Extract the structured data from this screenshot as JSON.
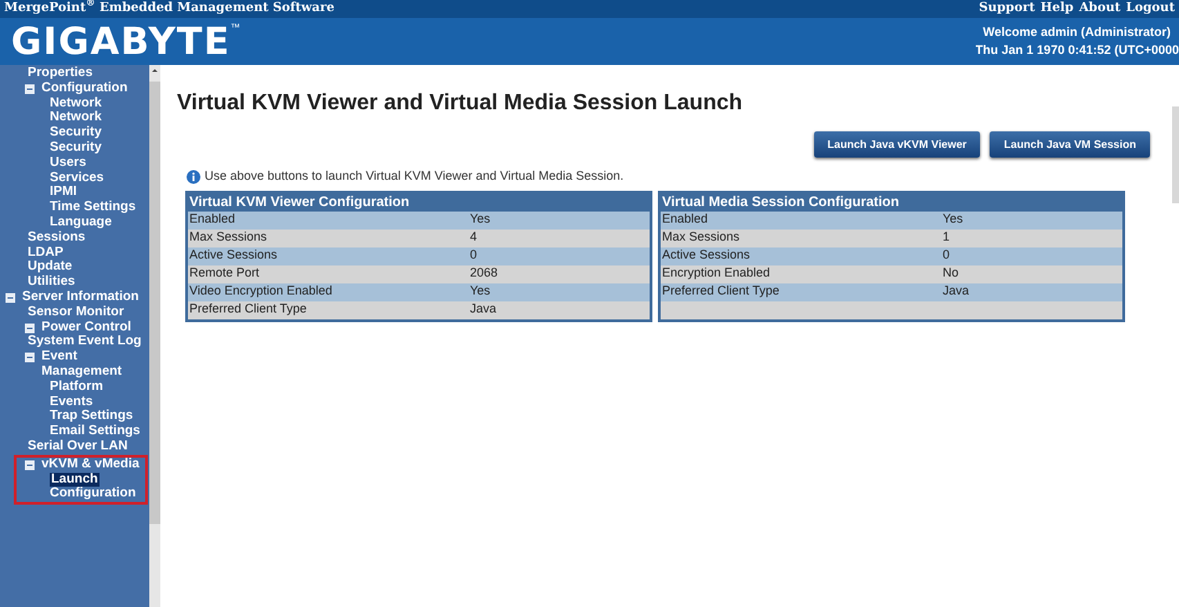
{
  "top_bar": {
    "product": "MergePoint$^{®}$ Embedded Management Software",
    "links": [
      "Support",
      "Help",
      "About",
      "Logout"
    ]
  },
  "header": {
    "logo": "GIGABYTE",
    "logo_mark": "™",
    "welcome": "Welcome admin (Administrator)",
    "datetime": "Thu Jan 1 1970 0:41:52 (UTC+0000"
  },
  "sidebar": {
    "items": [
      {
        "children": [
          {
            "label": "Properties",
            "expanded": false,
            "selected": false,
            "highlighted": false
          },
          {
            "label": "Configuration",
            "expanded": true,
            "selected": false,
            "highlighted": false,
            "children": [
              {
                "label": "Network",
                "expanded": false,
                "selected": false,
                "highlighted": false
              },
              {
                "label": "Network Security",
                "expanded": false,
                "selected": false,
                "highlighted": false
              },
              {
                "label": "Security",
                "expanded": false,
                "selected": false,
                "highlighted": false
              },
              {
                "label": "Users",
                "expanded": false,
                "selected": false,
                "highlighted": false
              },
              {
                "label": "Services",
                "expanded": false,
                "selected": false,
                "highlighted": false
              },
              {
                "label": "IPMI",
                "expanded": false,
                "selected": false,
                "highlighted": false
              },
              {
                "label": "Time Settings",
                "expanded": false,
                "selected": false,
                "highlighted": false
              },
              {
                "label": "Language",
                "expanded": false,
                "selected": false,
                "highlighted": false
              }
            ]
          },
          {
            "label": "Sessions",
            "expanded": false,
            "selected": false,
            "highlighted": false
          },
          {
            "label": "LDAP",
            "expanded": false,
            "selected": false,
            "highlighted": false
          },
          {
            "label": "Update",
            "expanded": false,
            "selected": false,
            "highlighted": false
          },
          {
            "label": "Utilities",
            "expanded": false,
            "selected": false,
            "highlighted": false
          }
        ]
      },
      {
        "label": "Server Information",
        "expanded": true,
        "selected": false,
        "highlighted": false,
        "children": [
          {
            "label": "Sensor Monitor",
            "expanded": false,
            "selected": false,
            "highlighted": false
          },
          {
            "label": "Power Control",
            "expanded": true,
            "selected": false,
            "highlighted": false
          },
          {
            "label": "System Event Log",
            "expanded": false,
            "selected": false,
            "highlighted": false
          },
          {
            "label": "Event Management",
            "expanded": true,
            "selected": false,
            "highlighted": false,
            "children": [
              {
                "label": "Platform Events",
                "expanded": false,
                "selected": false,
                "highlighted": false
              },
              {
                "label": "Trap Settings",
                "expanded": false,
                "selected": false,
                "highlighted": false
              },
              {
                "label": "Email Settings",
                "expanded": false,
                "selected": false,
                "highlighted": false
              }
            ]
          },
          {
            "label": "Serial Over LAN",
            "expanded": false,
            "selected": false,
            "highlighted": false
          },
          {
            "label": "vKVM & vMedia",
            "expanded": true,
            "selected": false,
            "highlighted": true,
            "children": [
              {
                "label": "Launch",
                "expanded": false,
                "selected": true,
                "highlighted": false
              },
              {
                "label": "Configuration",
                "expanded": false,
                "selected": false,
                "highlighted": false
              }
            ]
          }
        ]
      }
    ]
  },
  "main": {
    "title": "Virtual KVM Viewer and Virtual Media Session Launch",
    "buttons": [
      "Launch Java vKVM Viewer",
      "Launch Java VM Session"
    ],
    "info": "Use above buttons to launch Virtual KVM Viewer and Virtual Media Session.",
    "tables": [
      {
        "title": "Virtual KVM Viewer Configuration",
        "rows": [
          [
            "Enabled",
            "Yes"
          ],
          [
            "Max Sessions",
            "4"
          ],
          [
            "Active Sessions",
            "0"
          ],
          [
            "Remote Port",
            "2068"
          ],
          [
            "Video Encryption Enabled",
            "Yes"
          ],
          [
            "Preferred Client Type",
            "Java"
          ]
        ]
      },
      {
        "title": "Virtual Media Session Configuration",
        "rows": [
          [
            "Enabled",
            "Yes"
          ],
          [
            "Max Sessions",
            "1"
          ],
          [
            "Active Sessions",
            "0"
          ],
          [
            "Encryption Enabled",
            "No"
          ],
          [
            "Preferred Client Type",
            "Java"
          ],
          []
        ]
      }
    ]
  }
}
